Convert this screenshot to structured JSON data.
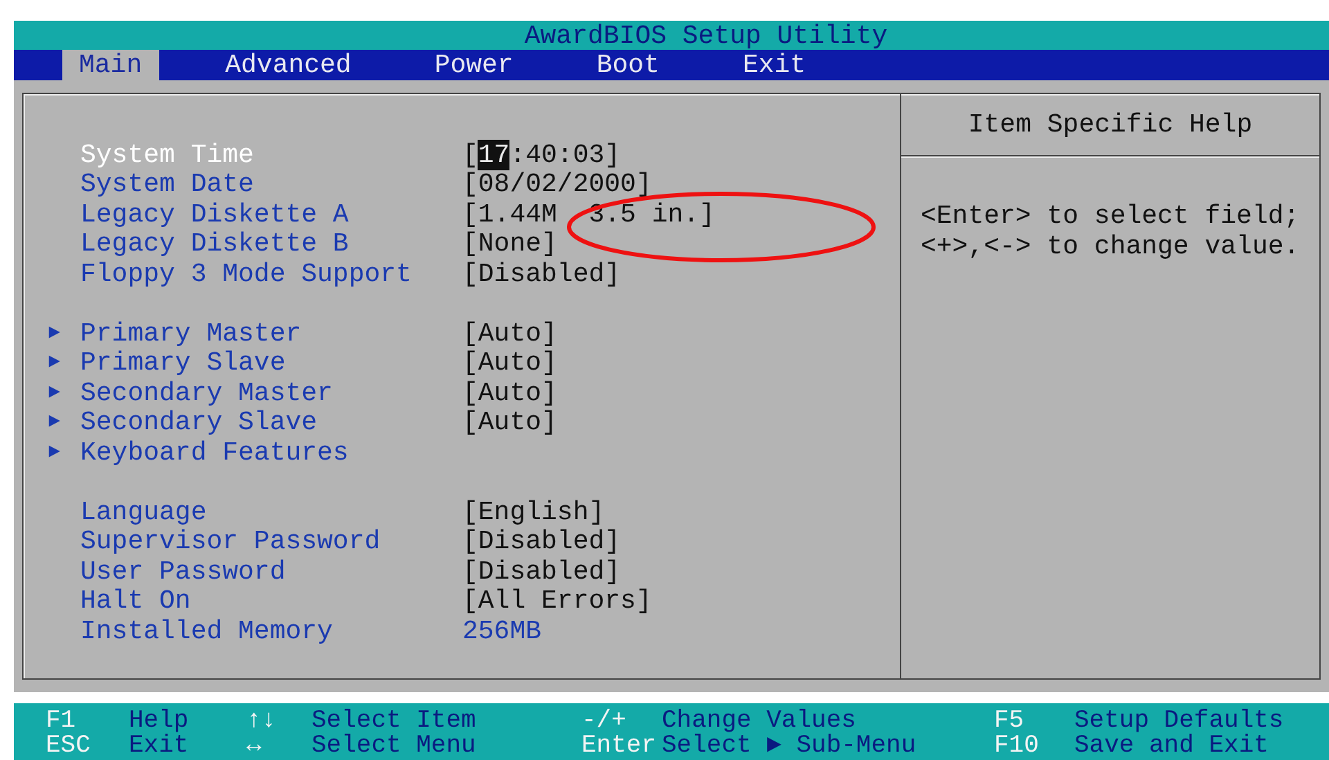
{
  "window": {
    "title": "AwardBIOS Setup Utility"
  },
  "tabs": [
    {
      "label": "Main",
      "selected": true
    },
    {
      "label": "Advanced",
      "selected": false
    },
    {
      "label": "Power",
      "selected": false
    },
    {
      "label": "Boot",
      "selected": false
    },
    {
      "label": "Exit",
      "selected": false
    }
  ],
  "groups": [
    {
      "items": [
        {
          "label": "System Time",
          "selected": true,
          "value": {
            "kind": "setting",
            "before": "[",
            "highlight": "17",
            "after": ":40:03]"
          }
        },
        {
          "label": "System Date",
          "selected": false,
          "value": {
            "kind": "setting",
            "text": "[08/02/2000]"
          }
        },
        {
          "label": "Legacy Diskette A",
          "selected": false,
          "value": {
            "kind": "setting",
            "text": "[1.44M  3.5 in.]"
          }
        },
        {
          "label": "Legacy Diskette B",
          "selected": false,
          "value": {
            "kind": "setting",
            "text": "[None]"
          }
        },
        {
          "label": "Floppy 3 Mode Support",
          "selected": false,
          "value": {
            "kind": "setting",
            "text": "[Disabled]"
          }
        }
      ]
    },
    {
      "items": [
        {
          "marker": "►",
          "label": "Primary Master",
          "selected": false,
          "value": {
            "kind": "setting",
            "text": "[Auto]"
          }
        },
        {
          "marker": "►",
          "label": "Primary Slave",
          "selected": false,
          "value": {
            "kind": "setting",
            "text": "[Auto]"
          }
        },
        {
          "marker": "►",
          "label": "Secondary Master",
          "selected": false,
          "value": {
            "kind": "setting",
            "text": "[Auto]"
          }
        },
        {
          "marker": "►",
          "label": "Secondary Slave",
          "selected": false,
          "value": {
            "kind": "setting",
            "text": "[Auto]"
          }
        },
        {
          "marker": "►",
          "label": "Keyboard Features",
          "selected": false
        }
      ]
    },
    {
      "items": [
        {
          "label": "Language",
          "selected": false,
          "value": {
            "kind": "setting",
            "text": "[English]"
          }
        },
        {
          "label": "Supervisor Password",
          "selected": false,
          "value": {
            "kind": "setting",
            "text": "[Disabled]"
          }
        },
        {
          "label": "User Password",
          "selected": false,
          "value": {
            "kind": "setting",
            "text": "[Disabled]"
          }
        },
        {
          "label": "Halt On",
          "selected": false,
          "value": {
            "kind": "setting",
            "text": "[All Errors]"
          }
        },
        {
          "label": "Installed Memory",
          "selected": false,
          "value": {
            "kind": "info",
            "text": "256MB"
          }
        }
      ]
    }
  ],
  "help": {
    "title": "Item Specific Help",
    "lines": [
      "<Enter> to select field;",
      "<+>,<-> to change value."
    ]
  },
  "annotations": [
    {
      "kind": "ellipse"
    }
  ],
  "footer": [
    [
      {
        "key": "F1",
        "action": "Help"
      },
      {
        "key": "↑↓",
        "action": "Select Item"
      },
      {
        "key": "-/+",
        "action": "Change Values"
      },
      {
        "key": "F5",
        "action": "Setup Defaults"
      }
    ],
    [
      {
        "key": "ESC",
        "action": "Exit"
      },
      {
        "key": "↔",
        "action": "Select Menu"
      },
      {
        "key": "Enter",
        "action": "Select ► Sub-Menu"
      },
      {
        "key": "F10",
        "action": "Save and Exit"
      }
    ]
  ]
}
